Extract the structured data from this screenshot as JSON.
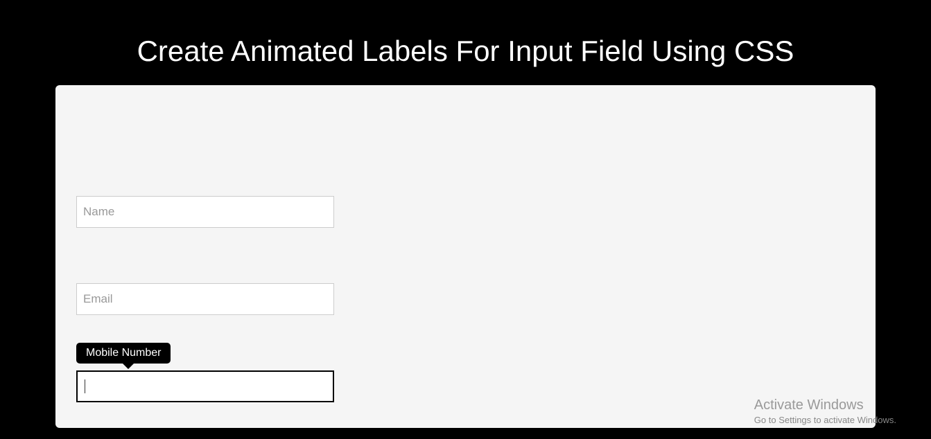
{
  "page": {
    "title": "Create Animated Labels For Input Field Using CSS"
  },
  "form": {
    "fields": [
      {
        "label": "Name",
        "value": "",
        "focused": false
      },
      {
        "label": "Email",
        "value": "",
        "focused": false
      },
      {
        "label": "Mobile Number",
        "value": "",
        "focused": true
      }
    ]
  },
  "watermark": {
    "title": "Activate Windows",
    "subtitle": "Go to Settings to activate Windows."
  }
}
